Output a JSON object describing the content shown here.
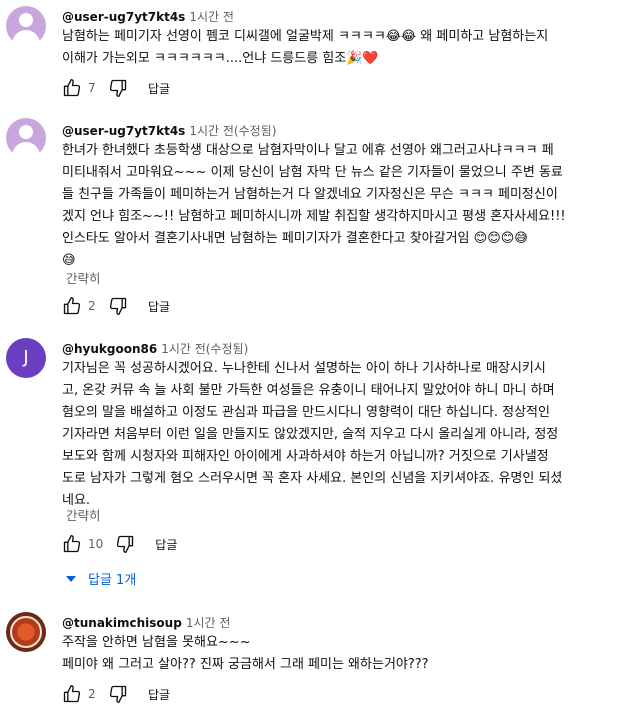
{
  "comments": [
    {
      "user": "@user-ug7yt7kt4s",
      "time": "1시간 전",
      "lines": [
        "남혐하는 페미기자 선영이 펨코 디씨갤에 얼굴박제 ㅋㅋㅋㅋ😂😂 왜 페미하고 남혐하는지",
        "이해가 가는외모 ㅋㅋㅋㅋㅋㅋ....언냐 드릉드릉 힘조🎉❤️"
      ],
      "likes": "7",
      "reply_label": "답글",
      "avatar_icon": "default-person-avatar-icon"
    },
    {
      "user": "@user-ug7yt7kt4s",
      "time": "1시간 전(수정됨)",
      "lines": [
        "한녀가 한녀했다 초등학생 대상으로 남혐자막이나 달고 에휴 선영아 왜그러고사냐ㅋㅋㅋ 페",
        "미티내줘서 고마워요~~~ 이제 당신이 남혐 자막 단 뉴스 같은 기자들이 물었으니 주변 동료",
        "들 친구들 가족들이 페미하는거 남혐하는거 다 알겠네요 기자정신은 무슨 ㅋㅋㅋ 페미정신이",
        "겠지 언냐 힘조~~!! 남혐하고 페미하시니까 제발 취집할 생각하지마시고 평생 혼자사세요!!!",
        "인스타도 알아서 결혼기사내면 남혐하는 페미기자가 결혼한다고 찾아갈거임 😊😊😊😅",
        "😅"
      ],
      "collapse_label": "간략히",
      "likes": "2",
      "reply_label": "답글",
      "avatar_icon": "default-person-avatar-icon"
    },
    {
      "user": "@hyukgoon86",
      "time": "1시간 전(수정됨)",
      "avatar_letter": "J",
      "lines": [
        "기자님은 꼭 성공하시겠어요. 누나한테 신나서 설명하는 아이 하나 기사하나로 매장시키시",
        "고, 온갖 커뮤 속 늘 사회 불만 가득한 여성들은 유충이니 태어나지 말았어야 하니 마니 하며",
        "혐오의 말을 배설하고 이정도 관심과 파급을 만드시다니 영향력이 대단 하십니다. 정상적인",
        "기자라면 처음부터 이런 일을 만들지도 않았겠지만, 슬적 지우고 다시 올리실게 아니라, 정정",
        "보도와 함께 시청자와 피해자인 아이에게 사과하셔야 하는거 아닙니까? 거짓으로 기사낼정",
        "도로 남자가 그렇게 혐오 스러우시면 꼭 혼자 사세요. 본인의 신념을 지키셔야죠. 유명인 되셨",
        "네요."
      ],
      "collapse_label": "간략히",
      "likes": "10",
      "reply_label": "답글",
      "replies_label": "답글 1개"
    },
    {
      "user": "@tunakimchisoup",
      "time": "1시간 전",
      "lines": [
        "주작을 안하면 남혐을 못해요~~~",
        "페미야 왜 그러고 살아?? 진짜 궁금해서 그래 페미는 왜하는거야???"
      ],
      "likes": "2",
      "reply_label": "답글",
      "avatar_icon": "food-bowl-avatar-icon"
    }
  ]
}
